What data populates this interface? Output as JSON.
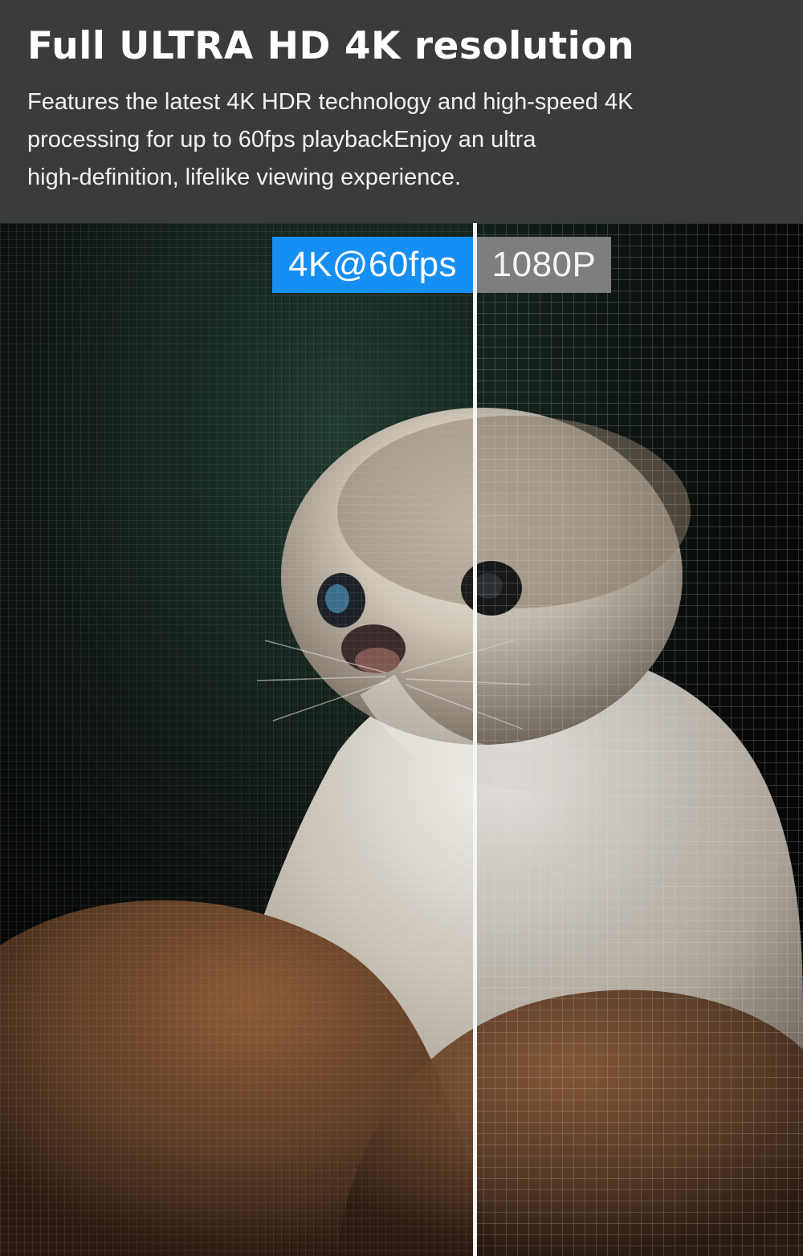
{
  "header": {
    "title": "Full ULTRA HD 4K resolution",
    "description_lines": [
      "Features the latest 4K HDR technology and high-speed 4K",
      "processing for up to 60fps playbackEnjoy an ultra",
      "high-definition, lifelike viewing experience."
    ]
  },
  "comparison": {
    "left_label": "4K@60fps",
    "right_label": "1080P"
  },
  "colors": {
    "header_bg": "#3a3b3d",
    "badge_4k": "#168ff5",
    "badge_1080": "#7d7e80"
  }
}
